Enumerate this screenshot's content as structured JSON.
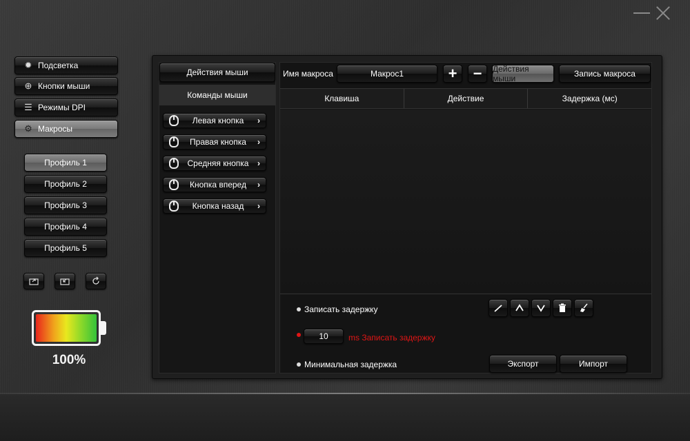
{
  "window": {
    "minimize_icon": "minimize-icon",
    "close_icon": "close-icon"
  },
  "nav": {
    "items": [
      {
        "label": "Подсветка",
        "icon": "sun-icon"
      },
      {
        "label": "Кнопки мыши",
        "icon": "crosshair-icon"
      },
      {
        "label": "Режимы DPI",
        "icon": "sliders-icon"
      },
      {
        "label": "Макросы",
        "icon": "gear-icon"
      }
    ],
    "active_index": 3
  },
  "profiles": {
    "items": [
      "Профиль 1",
      "Профиль 2",
      "Профиль 3",
      "Профиль 4",
      "Профиль 5"
    ],
    "active_index": 0
  },
  "profile_tools": [
    "export-profile-icon",
    "import-profile-icon",
    "reset-icon"
  ],
  "battery": {
    "level_text": "100%",
    "level": 1.0
  },
  "commands": {
    "tab_mouse_actions": "Действия мыши",
    "tab_mouse_commands": "Команды мыши",
    "buttons": [
      {
        "label": "Левая кнопка"
      },
      {
        "label": "Правая кнопка"
      },
      {
        "label": "Средняя кнопка"
      },
      {
        "label": "Кнопка вперед"
      },
      {
        "label": "Кнопка назад"
      }
    ]
  },
  "macro": {
    "name_label": "Имя макроса",
    "name_value": "Макрос1",
    "plus": "+",
    "minus": "−",
    "actions_button": "Действия мыши",
    "record_button": "Запись макроса"
  },
  "table": {
    "columns": [
      "Клавиша",
      "Действие",
      "Задержка (мс)"
    ],
    "rows": []
  },
  "options": {
    "record_delay": "Записать задержку",
    "delay_value": "10",
    "fixed_delay_label": "ms Записать задержку",
    "min_delay": "Минимальная задержка"
  },
  "tools": [
    "edit-icon",
    "move-up-icon",
    "move-down-icon",
    "delete-icon",
    "clear-icon"
  ],
  "footer": {
    "export": "Экспорт",
    "import": "Импорт"
  },
  "colors": {
    "accent_red": "#e01515",
    "active_button": "#7a7a7a"
  }
}
